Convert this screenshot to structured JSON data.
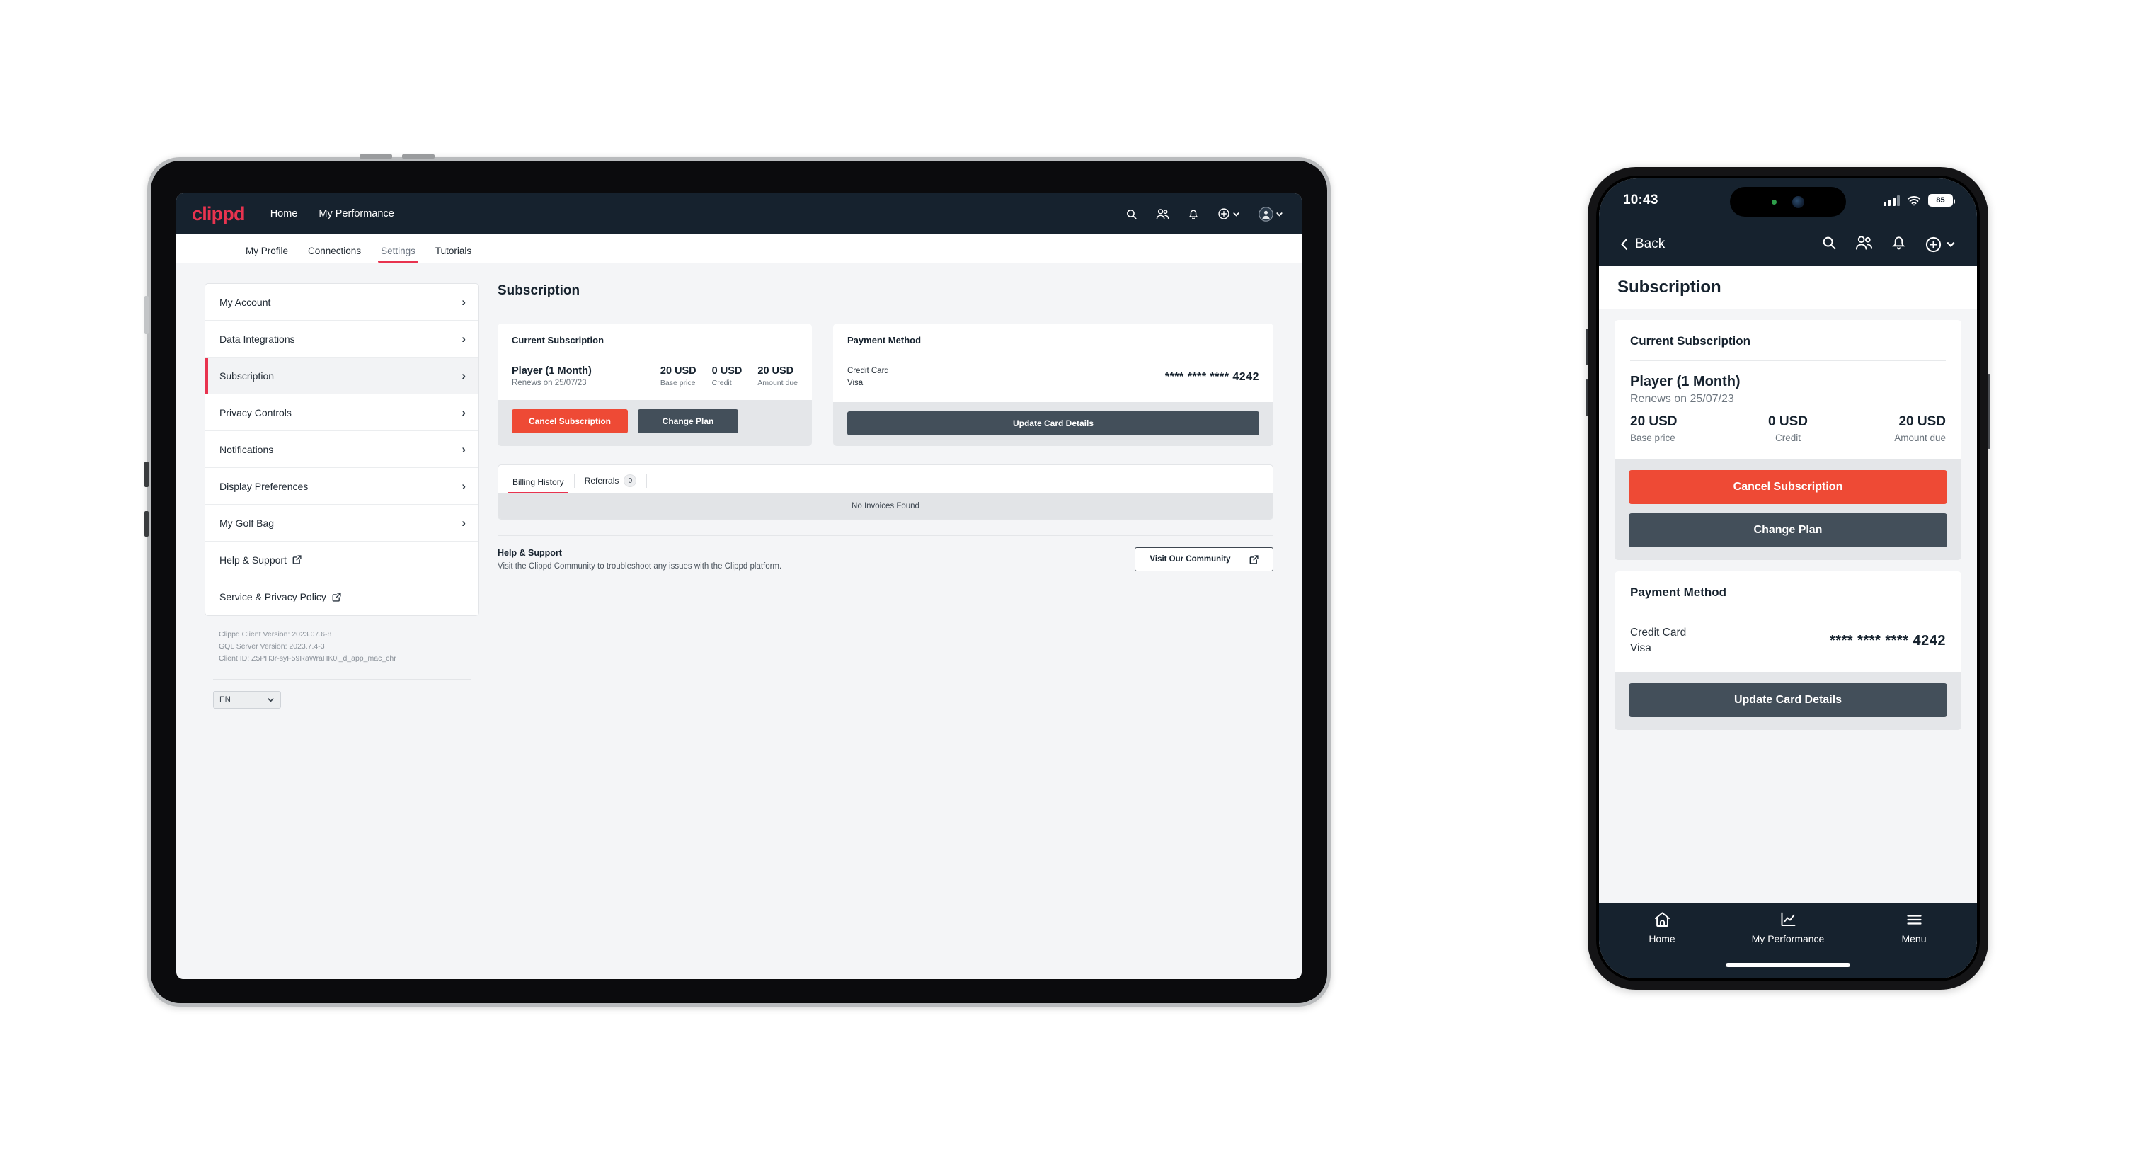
{
  "tablet": {
    "topnav": {
      "logo": "clippd",
      "links": [
        "Home",
        "My Performance"
      ],
      "icons": [
        "search-icon",
        "people-icon",
        "bell-icon",
        "plus-circle-icon",
        "avatar-icon"
      ]
    },
    "subtabs": [
      {
        "label": "My Profile",
        "active": false
      },
      {
        "label": "Connections",
        "active": false
      },
      {
        "label": "Settings",
        "active": true
      },
      {
        "label": "Tutorials",
        "active": false
      }
    ],
    "sidebar": {
      "items": [
        {
          "label": "My Account",
          "type": "chevron",
          "selected": false
        },
        {
          "label": "Data Integrations",
          "type": "chevron",
          "selected": false
        },
        {
          "label": "Subscription",
          "type": "chevron",
          "selected": true
        },
        {
          "label": "Privacy Controls",
          "type": "chevron",
          "selected": false
        },
        {
          "label": "Notifications",
          "type": "chevron",
          "selected": false
        },
        {
          "label": "Display Preferences",
          "type": "chevron",
          "selected": false
        },
        {
          "label": "My Golf Bag",
          "type": "chevron",
          "selected": false
        },
        {
          "label": "Help & Support",
          "type": "external",
          "selected": false
        },
        {
          "label": "Service & Privacy Policy",
          "type": "external",
          "selected": false
        }
      ],
      "versions": [
        "Clippd Client Version: 2023.07.6-8",
        "GQL Server Version: 2023.7.4-3",
        "Client ID: Z5PH3r-syF59RaWraHK0i_d_app_mac_chr"
      ],
      "language": "EN"
    },
    "page_title": "Subscription",
    "subscription_card": {
      "heading": "Current Subscription",
      "plan_name": "Player (1 Month)",
      "renews": "Renews on 25/07/23",
      "figures": [
        {
          "value": "20 USD",
          "label": "Base price"
        },
        {
          "value": "0 USD",
          "label": "Credit"
        },
        {
          "value": "20 USD",
          "label": "Amount due"
        }
      ],
      "cancel_label": "Cancel Subscription",
      "change_label": "Change Plan"
    },
    "payment_card": {
      "heading": "Payment Method",
      "type": "Credit Card",
      "brand": "Visa",
      "number": "**** **** **** 4242",
      "update_label": "Update Card Details"
    },
    "billing": {
      "tabs": [
        {
          "label": "Billing History",
          "active": true,
          "badge": null
        },
        {
          "label": "Referrals",
          "active": false,
          "badge": "0"
        }
      ],
      "empty_text": "No Invoices Found"
    },
    "help": {
      "heading": "Help & Support",
      "body": "Visit the Clippd Community to troubleshoot any issues with the Clippd platform.",
      "button_label": "Visit Our Community"
    }
  },
  "phone": {
    "status": {
      "time": "10:43",
      "battery": "85"
    },
    "nav": {
      "back_label": "Back",
      "icons": [
        "search-icon",
        "people-icon",
        "bell-icon",
        "plus-circle-icon"
      ]
    },
    "page_title": "Subscription",
    "subscription_card": {
      "heading": "Current Subscription",
      "plan_name": "Player (1 Month)",
      "renews": "Renews on 25/07/23",
      "figures": [
        {
          "value": "20 USD",
          "label": "Base price"
        },
        {
          "value": "0 USD",
          "label": "Credit"
        },
        {
          "value": "20 USD",
          "label": "Amount due"
        }
      ],
      "cancel_label": "Cancel Subscription",
      "change_label": "Change Plan"
    },
    "payment_card": {
      "heading": "Payment Method",
      "type": "Credit Card",
      "brand": "Visa",
      "number": "**** **** **** 4242",
      "update_label": "Update Card Details"
    },
    "tabbar": [
      {
        "label": "Home",
        "icon": "home-icon"
      },
      {
        "label": "My Performance",
        "icon": "chart-icon"
      },
      {
        "label": "Menu",
        "icon": "hamburger-icon"
      }
    ]
  },
  "colors": {
    "brand_red": "#e8334f",
    "danger": "#ee4a35",
    "slate": "#434f5a",
    "navy": "#16222e"
  }
}
